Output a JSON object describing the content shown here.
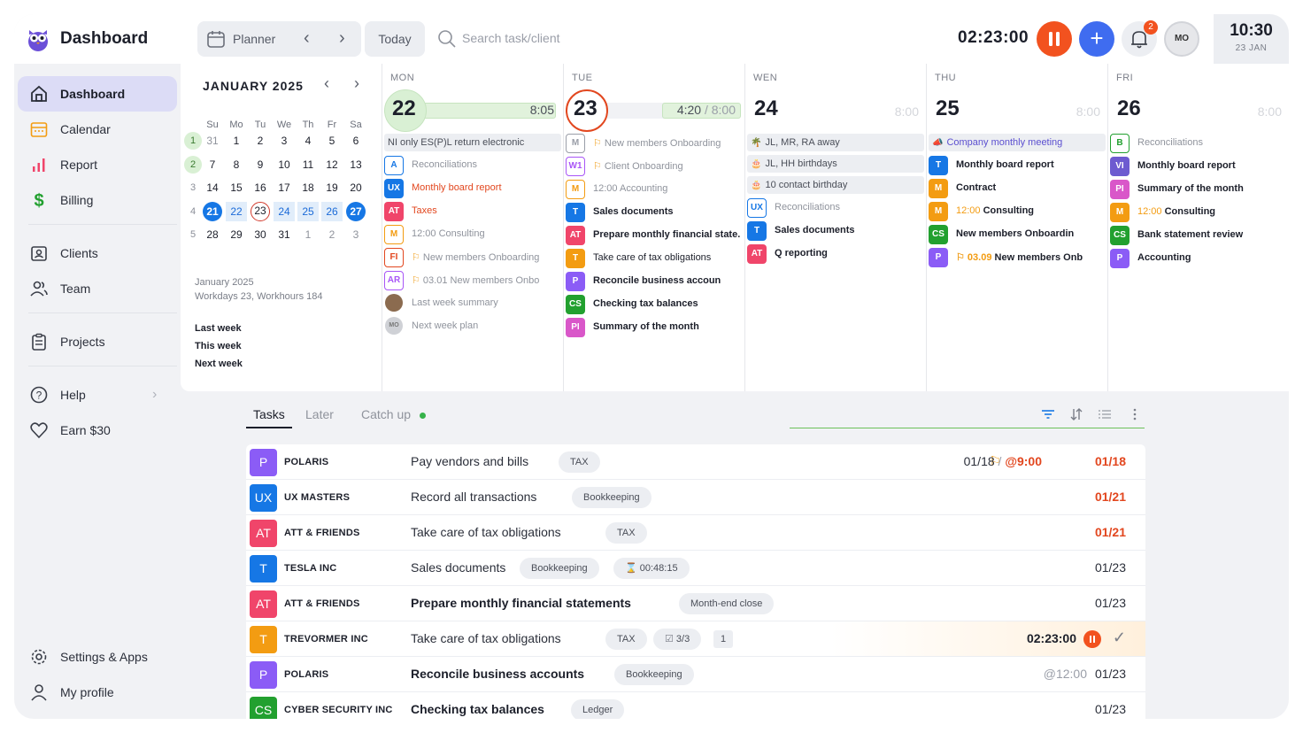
{
  "brand": "Dashboard",
  "header": {
    "planner_label": "Planner",
    "today_label": "Today",
    "search_placeholder": "Search task/client",
    "timer": "02:23:00",
    "notifications": "2",
    "avatar": "MO",
    "clock_time": "10:30",
    "clock_date": "23 JAN"
  },
  "sidebar": {
    "items": [
      {
        "label": "Dashboard",
        "icon": "home-icon"
      },
      {
        "label": "Calendar",
        "icon": "calendar-icon"
      },
      {
        "label": "Report",
        "icon": "bar-chart-icon"
      },
      {
        "label": "Billing",
        "icon": "dollar-icon"
      },
      {
        "label": "Clients",
        "icon": "clients-icon"
      },
      {
        "label": "Team",
        "icon": "team-icon"
      },
      {
        "label": "Projects",
        "icon": "projects-icon"
      },
      {
        "label": "Help",
        "icon": "help-icon"
      },
      {
        "label": "Earn $30",
        "icon": "heart-icon"
      },
      {
        "label": "Settings & Apps",
        "icon": "gear-icon"
      },
      {
        "label": "My profile",
        "icon": "user-icon"
      }
    ]
  },
  "mini_calendar": {
    "title": "JANUARY 2025",
    "dow": [
      "Su",
      "Mo",
      "Tu",
      "We",
      "Th",
      "Fr",
      "Sa"
    ],
    "weeks": [
      {
        "wk": "1",
        "days": [
          "31",
          "1",
          "2",
          "3",
          "4",
          "5",
          "6"
        ]
      },
      {
        "wk": "2",
        "days": [
          "7",
          "8",
          "9",
          "10",
          "11",
          "12",
          "13"
        ]
      },
      {
        "wk": "3",
        "days": [
          "14",
          "15",
          "16",
          "17",
          "18",
          "19",
          "20"
        ]
      },
      {
        "wk": "4",
        "days": [
          "21",
          "22",
          "23",
          "24",
          "25",
          "26",
          "27"
        ]
      },
      {
        "wk": "5",
        "days": [
          "28",
          "29",
          "30",
          "31",
          "1",
          "2",
          "3"
        ]
      }
    ],
    "info_month": "January 2025",
    "info_work": "Workdays 23, Workhours 184",
    "quick": [
      "Last week",
      "This week",
      "Next week"
    ]
  },
  "days": [
    {
      "dow": "MON",
      "num": "22",
      "hours": "8:05",
      "events": [
        {
          "text": "NI only ES(P)L return electronic"
        }
      ],
      "tasks": [
        {
          "badge": "A",
          "color": "#1677e5",
          "style": "outline",
          "text": "Reconciliations",
          "tone": "faded"
        },
        {
          "badge": "UX",
          "color": "#1677e5",
          "style": "solid",
          "text": "Monthly board report",
          "tone": "orange"
        },
        {
          "badge": "AT",
          "color": "#f0456a",
          "style": "solid",
          "text": "Taxes",
          "tone": "orange"
        },
        {
          "badge": "M",
          "color": "#f39c12",
          "style": "outline",
          "text": "12:00 Consulting",
          "tone": "faded"
        },
        {
          "badge": "FI",
          "color": "#e2471f",
          "style": "outline",
          "text": "New members Onboarding",
          "tone": "faded",
          "flag": true
        },
        {
          "badge": "AR",
          "color": "#a855f7",
          "style": "outline",
          "text": "03.01 New members Onbo",
          "tone": "faded",
          "flag": true
        },
        {
          "badge": "",
          "color": "#8b6b4f",
          "style": "avatar",
          "text": "Last week summary",
          "tone": "faded"
        },
        {
          "badge": "MO",
          "color": "#cfd1d6",
          "style": "avatar",
          "text": "Next week plan",
          "tone": "faded"
        }
      ]
    },
    {
      "dow": "TUE",
      "num": "23",
      "hours_done": "4:20",
      "hours_total": "8:00",
      "tasks": [
        {
          "badge": "M",
          "color": "#9a9ea8",
          "style": "outline",
          "text": "New members Onboarding",
          "tone": "faded",
          "flag": true
        },
        {
          "badge": "W1",
          "color": "#a855f7",
          "style": "outline",
          "text": "Client Onboarding",
          "tone": "faded",
          "flag": true
        },
        {
          "badge": "M",
          "color": "#f39c12",
          "style": "outline",
          "text": "12:00 Accounting",
          "tone": "faded"
        },
        {
          "badge": "T",
          "color": "#1677e5",
          "style": "solid",
          "text": "Sales documents",
          "tone": "strong"
        },
        {
          "badge": "AT",
          "color": "#f0456a",
          "style": "solid",
          "text": "Prepare monthly financial state.",
          "tone": "strong"
        },
        {
          "badge": "T",
          "color": "#f39c12",
          "style": "solid",
          "text": "Take care of tax obligations",
          "tone": "normal"
        },
        {
          "badge": "P",
          "color": "#8b5cf6",
          "style": "solid",
          "text": "Reconcile business accoun",
          "tone": "strong"
        },
        {
          "badge": "CS",
          "color": "#22a02f",
          "style": "solid",
          "text": "Checking tax balances",
          "tone": "strong"
        },
        {
          "badge": "PI",
          "color": "#d957c9",
          "style": "solid",
          "text": "Summary of the month",
          "tone": "strong"
        }
      ]
    },
    {
      "dow": "WEN",
      "num": "24",
      "hours": "8:00",
      "events": [
        {
          "text": "JL, MR, RA away",
          "icon": "palm-icon"
        },
        {
          "text": "JL, HH birthdays",
          "icon": "cake-icon"
        },
        {
          "text": "10 contact birthday",
          "icon": "cake-icon"
        }
      ],
      "tasks": [
        {
          "badge": "UX",
          "color": "#1677e5",
          "style": "outline",
          "text": "Reconciliations",
          "tone": "faded"
        },
        {
          "badge": "T",
          "color": "#1677e5",
          "style": "solid",
          "text": "Sales documents",
          "tone": "strong"
        },
        {
          "badge": "AT",
          "color": "#f0456a",
          "style": "solid",
          "text": "Q reporting",
          "tone": "strong"
        }
      ]
    },
    {
      "dow": "THU",
      "num": "25",
      "hours": "8:00",
      "events": [
        {
          "text": "Company monthly meeting",
          "icon": "megaphone-icon"
        }
      ],
      "tasks": [
        {
          "badge": "T",
          "color": "#1677e5",
          "style": "solid",
          "text": "Monthly board report",
          "tone": "strong"
        },
        {
          "badge": "M",
          "color": "#f39c12",
          "style": "solid",
          "text": "Contract",
          "tone": "strong"
        },
        {
          "badge": "M",
          "color": "#f39c12",
          "style": "solid",
          "text": "Consulting",
          "time": "12:00",
          "tone": "strong"
        },
        {
          "badge": "CS",
          "color": "#22a02f",
          "style": "solid",
          "text": "New members Onboardin",
          "tone": "strong"
        },
        {
          "badge": "P",
          "color": "#8b5cf6",
          "style": "solid",
          "text": "New members Onb",
          "time": "03.09",
          "tone": "strong",
          "flag": true
        }
      ]
    },
    {
      "dow": "FRI",
      "num": "26",
      "hours": "8:00",
      "tasks": [
        {
          "badge": "B",
          "color": "#22a02f",
          "style": "outline",
          "text": "Reconciliations",
          "tone": "faded"
        },
        {
          "badge": "VI",
          "color": "#6d5bd0",
          "style": "solid",
          "text": "Monthly board report",
          "tone": "strong"
        },
        {
          "badge": "PI",
          "color": "#d957c9",
          "style": "solid",
          "text": "Summary of the month",
          "tone": "strong"
        },
        {
          "badge": "M",
          "color": "#f39c12",
          "style": "solid",
          "text": "Consulting",
          "time": "12:00",
          "tone": "strong"
        },
        {
          "badge": "CS",
          "color": "#22a02f",
          "style": "solid",
          "text": "Bank statement review",
          "tone": "strong"
        },
        {
          "badge": "P",
          "color": "#8b5cf6",
          "style": "solid",
          "text": "Accounting",
          "tone": "strong"
        }
      ]
    }
  ],
  "tabs": [
    "Tasks",
    "Later",
    "Catch up"
  ],
  "tasks": [
    {
      "av": "P",
      "color": "#8b5cf6",
      "client": "POLARIS",
      "title": "Pay vendors and bills",
      "bold": false,
      "chips": [
        "TAX"
      ],
      "flag": true,
      "due_prefix": "01/18",
      "due_time": "@9:00",
      "due": "01/18",
      "due_red": true
    },
    {
      "av": "UX",
      "color": "#1677e5",
      "client": "UX MASTERS",
      "title": "Record all transactions",
      "bold": false,
      "chips": [
        "Bookkeeping"
      ],
      "due": "01/21",
      "due_red": true
    },
    {
      "av": "AT",
      "color": "#f0456a",
      "client": "ATT & FRIENDS",
      "title": "Take care of tax obligations",
      "bold": false,
      "chips": [
        "TAX"
      ],
      "due": "01/21",
      "due_red": true
    },
    {
      "av": "T",
      "color": "#1677e5",
      "client": "TESLA INC",
      "title": "Sales documents",
      "bold": false,
      "chips": [
        "Bookkeeping",
        "00:48:15"
      ],
      "due": "01/23",
      "due_red": false
    },
    {
      "av": "AT",
      "color": "#f0456a",
      "client": "ATT & FRIENDS",
      "title": "Prepare monthly financial statements",
      "bold": true,
      "chips": [
        "Month-end close"
      ],
      "due": "01/23",
      "due_red": false
    },
    {
      "av": "T",
      "color": "#f39c12",
      "client": "TREVORMER INC",
      "title": "Take care of tax obligations",
      "bold": false,
      "chips": [
        "TAX",
        "3/3",
        "1"
      ],
      "timer": "02:23:00",
      "active": true
    },
    {
      "av": "P",
      "color": "#8b5cf6",
      "client": "POLARIS",
      "title": "Reconcile business accounts",
      "bold": true,
      "chips": [
        "Bookkeeping"
      ],
      "due_time_gray": "@12:00",
      "due": "01/23",
      "due_red": false
    },
    {
      "av": "CS",
      "color": "#22a02f",
      "client": "CYBER SECURITY INC",
      "title": "Checking tax balances",
      "bold": true,
      "chips": [
        "Ledger"
      ],
      "due": "01/23",
      "due_red": false
    }
  ],
  "colors": {
    "accent": "#3f6cf0",
    "danger": "#f2521f",
    "active_nav": "#dcdcf6"
  }
}
